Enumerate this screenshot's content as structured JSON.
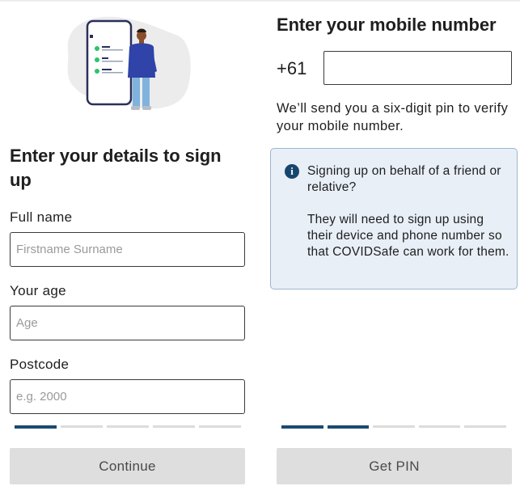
{
  "signup_details": {
    "heading": "Enter your details to sign up",
    "fields": [
      {
        "label": "Full name",
        "placeholder": "Firstname Surname",
        "value": ""
      },
      {
        "label": "Your age",
        "placeholder": "Age",
        "value": ""
      },
      {
        "label": "Postcode",
        "placeholder": "e.g. 2000",
        "value": ""
      }
    ],
    "progress": {
      "steps": 5,
      "current": 1
    },
    "continue_label": "Continue"
  },
  "mobile_number": {
    "heading": "Enter your mobile number",
    "country_code": "+61",
    "phone_value": "",
    "description": "We’ll send you a six-digit pin to verify your mobile number.",
    "info_box": {
      "icon": "info-icon",
      "title": "Signing up on behalf of a friend or relative?",
      "body": "They will need to sign up using their device and phone number so that COVIDSafe can work for them."
    },
    "progress": {
      "steps": 5,
      "current": 2
    },
    "get_pin_label": "Get PIN"
  },
  "colors": {
    "accent": "#1b4a72",
    "progress_inactive": "#dcdcdc",
    "button_disabled": "#dedede",
    "info_background": "#e8eff7",
    "info_border": "#9fb6cc",
    "illustration_blob": "#ececec",
    "illustration_green": "#2fc36b",
    "person_sweater": "#2f43a8",
    "person_pants": "#7fb3dd"
  }
}
